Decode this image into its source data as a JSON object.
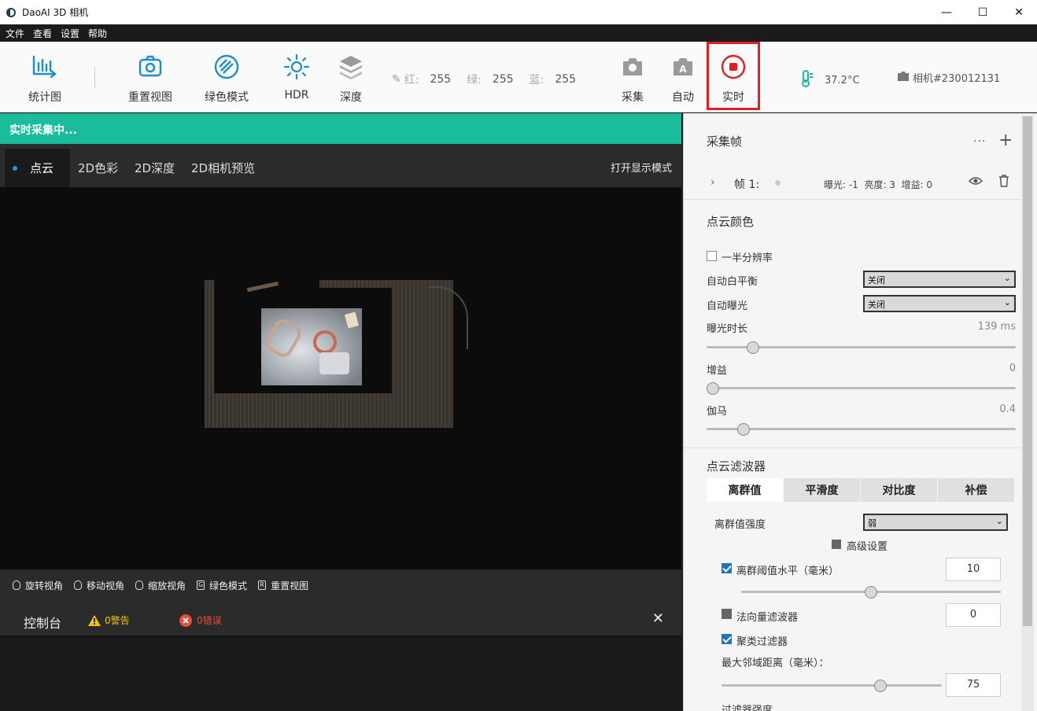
{
  "window": {
    "title": "DaoAI 3D 相机",
    "minimize": "—",
    "maximize": "☐",
    "close": "✕"
  },
  "menu": [
    "文件",
    "查看",
    "设置",
    "帮助"
  ],
  "toolbar": {
    "stats": "统计图",
    "reset_view": "重置视图",
    "green_mode": "绿色模式",
    "hdr": "HDR",
    "depth": "深度",
    "capture": "采集",
    "auto": "自动",
    "realtime": "实时",
    "rgb": {
      "r_label": "红:",
      "r": "255",
      "g_label": "绿:",
      "g": "255",
      "b_label": "蓝:",
      "b": "255"
    },
    "temperature": "37.2°C",
    "camera": "相机#230012131"
  },
  "status": "实时采集中...",
  "view_tabs": [
    "点云",
    "2D色彩",
    "2D深度",
    "2D相机预览"
  ],
  "display_mode": "打开显示模式",
  "hints": [
    "旋转视角",
    "移动视角",
    "缩放视角",
    "绿色模式",
    "重置视图"
  ],
  "hint_keys": [
    "",
    "",
    "",
    "G",
    "R"
  ],
  "console": {
    "title": "控制台",
    "warnings": "0警告",
    "errors": "0错误",
    "close": "✕"
  },
  "panel": {
    "frames": {
      "title": "采集帧",
      "more": "···",
      "add": "+",
      "frame_label": "帧 1:",
      "frame_info": "曝光: -1  亮度: 3  增益: 0"
    },
    "color": {
      "title": "点云颜色",
      "half_res": "一半分辨率",
      "awb_label": "自动白平衡",
      "awb_value": "关闭",
      "ae_label": "自动曝光",
      "ae_value": "关闭",
      "exposure_label": "曝光时长",
      "exposure_value": "139 ms",
      "exposure_level": 0.15,
      "gain_label": "增益",
      "gain_value": "0",
      "gain_level": 0.0,
      "gamma_label": "伽马",
      "gamma_value": "0.4",
      "gamma_level": 0.12
    },
    "filter": {
      "title": "点云滤波器",
      "tabs": [
        "离群值",
        "平滑度",
        "对比度",
        "补偿"
      ],
      "strength_label": "离群值强度",
      "strength_value": "弱",
      "advanced": "高级设置",
      "threshold_label": "离群阈值水平（毫米）",
      "threshold_value": "10",
      "threshold_level": 0.5,
      "normal_label": "法向量滤波器",
      "normal_value": "0",
      "cluster_label": "聚类过滤器",
      "neighbor_label": "最大邻域距离（毫米）：",
      "neighbor_value": "75",
      "neighbor_level": 0.72,
      "more_label": "过滤器强度"
    }
  },
  "colors": {
    "accent": "#1abc9c",
    "record_red": "#e02020",
    "check_blue": "#1f73c7"
  }
}
